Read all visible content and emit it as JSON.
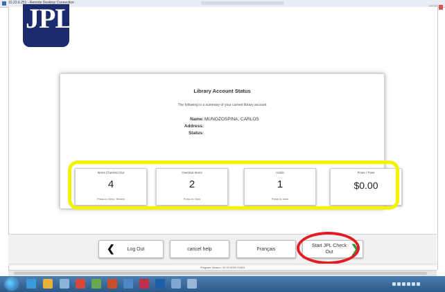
{
  "window": {
    "title": "10.22.6.251 - Remote Desktop Connection"
  },
  "logo": {
    "text": "JPL"
  },
  "account": {
    "title": "Library Account Status",
    "subtitle": "The following is a summary of your current library account",
    "name_label": "Name:",
    "name_value": "MUNOZOSPINA, CARLOS",
    "address_label": "Address:",
    "address_value": "",
    "status_label": "Status:",
    "status_value": ""
  },
  "tiles": [
    {
      "label": "Items Checked Out",
      "value": "4",
      "footer": "Press to View / Renew"
    },
    {
      "label": "Overdue Items",
      "value": "2",
      "footer": "Press to View"
    },
    {
      "label": "Holds",
      "value": "1",
      "footer": "Press to View"
    },
    {
      "label": "Fines / Fees",
      "value": "$0.00",
      "footer": ""
    }
  ],
  "buttons": {
    "logout": "Log Out",
    "cancel_help": "cancel help",
    "language": "Français",
    "start_checkout_line1": "Start JPL Check",
    "start_checkout_line2": "Out"
  },
  "version": "Program Version: 02.00.0000.21603",
  "colors": {
    "logo_bg": "#1c2a6e",
    "highlight_yellow": "#f4f400",
    "annotation_red": "#e31b23",
    "next_arrow_green": "#2e9a44",
    "taskbar_blue": "#2c5a88"
  },
  "taskbar_icons": [
    "windows-start-icon",
    "ie-icon",
    "explorer-icon",
    "media-icon",
    "chrome-icon",
    "app-icon",
    "app-icon",
    "app-icon",
    "outlook-icon",
    "app-icon",
    "app-icon"
  ]
}
